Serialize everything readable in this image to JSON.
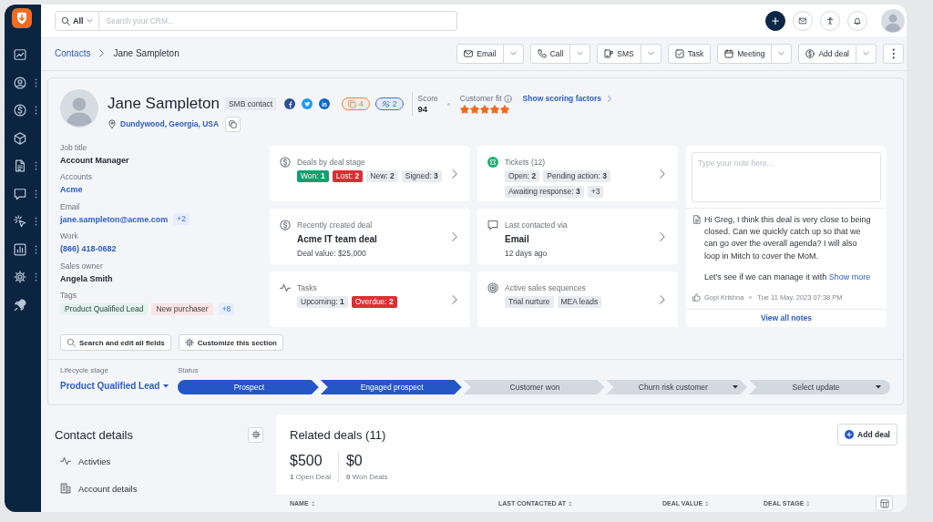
{
  "topbar": {
    "search_scope": "All",
    "search_placeholder": "Search your CRM..."
  },
  "breadcrumb": {
    "parent": "Contacts",
    "current": "Jane Sampleton"
  },
  "actions": [
    {
      "kind": "email",
      "label": "Email",
      "dropdown": true
    },
    {
      "kind": "call",
      "label": "Call",
      "dropdown": true
    },
    {
      "kind": "sms",
      "label": "SMS",
      "dropdown": true
    },
    {
      "kind": "task",
      "label": "Task",
      "dropdown": false
    },
    {
      "kind": "meeting",
      "label": "Meeting",
      "dropdown": true
    },
    {
      "kind": "deal",
      "label": "Add deal",
      "dropdown": true
    }
  ],
  "profile": {
    "name": "Jane Sampleton",
    "segment": "SMB contact",
    "location": "Dundywood, Georgia, USA",
    "counters": [
      {
        "kind": "files",
        "count": "4",
        "color": "#e8833a"
      },
      {
        "kind": "contacts",
        "count": "2",
        "color": "#3f73d8"
      }
    ],
    "score_label": "Score",
    "score": "94",
    "fit_label": "Customer fit",
    "stars": 5,
    "scoring_link": "Show scoring factors"
  },
  "fields": [
    {
      "label": "Job title",
      "kind": "text",
      "value": "Account Manager"
    },
    {
      "label": "Accounts",
      "kind": "link",
      "value": "Acme"
    },
    {
      "label": "Email",
      "kind": "link",
      "value": "jane.sampleton@acme.com",
      "more": "+2"
    },
    {
      "label": "Work",
      "kind": "link",
      "value": "(866) 418-0682"
    },
    {
      "label": "Sales owner",
      "kind": "text",
      "value": "Angela Smith"
    },
    {
      "label": "Tags",
      "kind": "tags",
      "tags": [
        {
          "label": "Product Qualified Lead",
          "color": "#e2f4eb"
        },
        {
          "label": "New purchaser",
          "color": "#fbe4e6"
        }
      ],
      "more": "+8"
    }
  ],
  "field_buttons": [
    {
      "kind": "search",
      "label": "Search and edit all fields"
    },
    {
      "kind": "customize",
      "label": "Customize this section"
    }
  ],
  "cards": [
    {
      "kind": "deals",
      "title": "Deals by deal stage",
      "chips": [
        {
          "text": "Won: **1**",
          "color": "#12a06e"
        },
        {
          "text": "Lost: **2**",
          "color": "#dc2f34"
        },
        {
          "text": "New: **2**",
          "color": "#e8ebef"
        },
        {
          "text": "Signed: **3**",
          "color": "#e8ebef"
        }
      ]
    },
    {
      "kind": "tickets",
      "title": "Tickets (12)",
      "chips": [
        {
          "text": "Open: **2**",
          "color": "#e8ebef"
        },
        {
          "text": "Pending action: **3**",
          "color": "#e8ebef"
        },
        {
          "text": "Awaiting response: **3**",
          "color": "#e8ebef"
        },
        {
          "text": "+3",
          "color": "#e8ebef"
        }
      ]
    },
    {
      "kind": "recent_deal",
      "title": "Recently created deal",
      "headline": "Acme IT team deal",
      "detail": "Deal value: $25,000"
    },
    {
      "kind": "contacted",
      "title": "Last contacted via",
      "headline": "Email",
      "detail": "12 days ago"
    },
    {
      "kind": "tasks",
      "title": "Tasks",
      "chips": [
        {
          "text": "Upcoming: **1**",
          "color": "#e8ebef"
        },
        {
          "text": "Overdue: **2**",
          "color": "#dc2f34"
        }
      ]
    },
    {
      "kind": "sequences",
      "title": "Active sales sequences",
      "chips": [
        {
          "text": "Trial nurture",
          "color": "#e8ebef"
        },
        {
          "text": "MEA leads",
          "color": "#e8ebef"
        }
      ]
    }
  ],
  "notes": {
    "placeholder": "Type your note here...",
    "paragraphs": [
      "Hi Greg, I think this deal is very close to being closed. Can we quickly catch up so that we can go over the overall agenda? I will also loop in Mitch to cover the MoM.",
      "Let's see if we can manage it with"
    ],
    "more_link": "Show more",
    "author": "Gopi Krishna",
    "time": "Tue 11 May, 2023 07:38 PM",
    "view_all": "View all notes"
  },
  "lifecycle": {
    "label": "Lifecycle stage",
    "value": "Product Qualified Lead",
    "status_label": "Status",
    "steps": [
      {
        "label": "Prospect",
        "reached": true,
        "dropdown": false
      },
      {
        "label": "Engaged prospect",
        "reached": true,
        "dropdown": false
      },
      {
        "label": "Customer won",
        "reached": false,
        "dropdown": false
      },
      {
        "label": "Churn risk customer",
        "reached": false,
        "dropdown": true
      },
      {
        "label": "Select update",
        "reached": false,
        "dropdown": true
      }
    ]
  },
  "contact_details": {
    "title": "Contact details",
    "items": [
      {
        "kind": "activities",
        "label": "Activties"
      },
      {
        "kind": "account",
        "label": "Account details"
      }
    ]
  },
  "related_deals": {
    "title": "Related deals (11)",
    "add_button": "Add deal",
    "stats": [
      {
        "value": "$500",
        "caption": "**1** Open Deal"
      },
      {
        "value": "$0",
        "caption": "**0** Won Deals"
      }
    ],
    "columns": [
      "NAME",
      "LAST CONTACTED AT",
      "DEAL VALUE",
      "DEAL STAGE"
    ]
  }
}
